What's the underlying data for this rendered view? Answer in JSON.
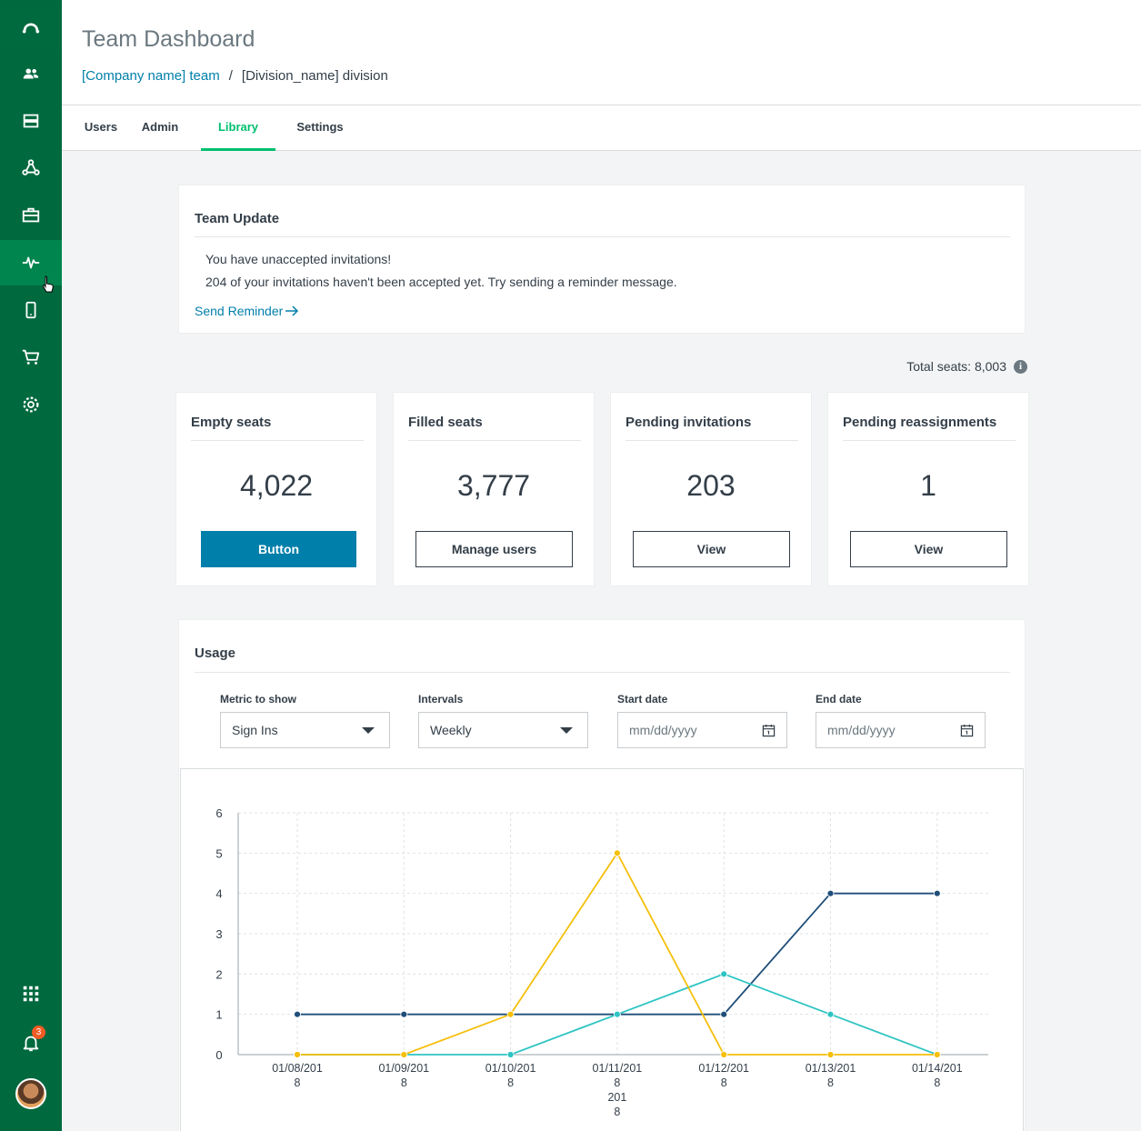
{
  "header": {
    "title": "Team Dashboard",
    "breadcrumb": {
      "link": "[Company name] team",
      "separator": "/",
      "current": "[Division_name] division"
    }
  },
  "tabs": [
    {
      "label": "Users",
      "active": false
    },
    {
      "label": "Admin",
      "active": false
    },
    {
      "label": "Library",
      "active": true
    },
    {
      "label": "Settings",
      "active": false
    }
  ],
  "sidebar": {
    "items": [
      {
        "icon": "logo-icon"
      },
      {
        "icon": "users-icon"
      },
      {
        "icon": "stack-icon"
      },
      {
        "icon": "network-icon"
      },
      {
        "icon": "briefcase-icon"
      },
      {
        "icon": "pulse-icon",
        "active": true
      },
      {
        "icon": "mobile-icon"
      },
      {
        "icon": "cart-icon"
      },
      {
        "icon": "gear-icon"
      },
      {
        "icon": "apps-grid-icon"
      },
      {
        "icon": "bell-icon",
        "badge": "3"
      },
      {
        "icon": "avatar"
      }
    ]
  },
  "team_update": {
    "title": "Team Update",
    "line1": "You have unaccepted invitations!",
    "line2": "204 of your invitations haven't been accepted yet. Try sending a reminder message.",
    "link": "Send Reminder"
  },
  "total_seats": "Total seats: 8,003",
  "stats": [
    {
      "title": "Empty seats",
      "value": "4,022",
      "button": "Button",
      "primary": true
    },
    {
      "title": "Filled seats",
      "value": "3,777",
      "button": "Manage users",
      "primary": false
    },
    {
      "title": "Pending invitations",
      "value": "203",
      "button": "View",
      "primary": false
    },
    {
      "title": "Pending reassignments",
      "value": "1",
      "button": "View",
      "primary": false
    }
  ],
  "usage": {
    "title": "Usage",
    "metric": {
      "label": "Metric to show",
      "value": "Sign Ins"
    },
    "intervals": {
      "label": "Intervals",
      "value": "Weekly"
    },
    "start_date": {
      "label": "Start date",
      "placeholder": "mm/dd/yyyy"
    },
    "end_date": {
      "label": "End date",
      "placeholder": "mm/dd/yyyy"
    }
  },
  "colors": {
    "sidebar": "#00693e",
    "accent": "#00bf6f",
    "link": "#007faa",
    "series_navy": "#1f4e79",
    "series_teal": "#2ec4c4",
    "series_yellow": "#f5bf0a"
  },
  "chart_data": {
    "type": "line",
    "x": [
      "01/08/2018",
      "01/09/2018",
      "01/10/2018",
      "01/11/2018",
      "01/12/2018",
      "01/13/2018",
      "01/14/2018"
    ],
    "x_tick_labels": [
      [
        "01/08/201",
        "8"
      ],
      [
        "01/09/201",
        "8"
      ],
      [
        "01/10/201",
        "8"
      ],
      [
        "01/11/201",
        "8",
        "201",
        "8"
      ],
      [
        "01/12/201",
        "8"
      ],
      [
        "01/13/201",
        "8"
      ],
      [
        "01/14/201",
        "8"
      ]
    ],
    "ylim": [
      0,
      6
    ],
    "yticks": [
      0,
      1,
      2,
      3,
      4,
      5,
      6
    ],
    "grid": true,
    "series": [
      {
        "color": "#1f4e79",
        "values": [
          1,
          1,
          1,
          1,
          1,
          4,
          4
        ]
      },
      {
        "color": "#2ec4c4",
        "values": [
          0,
          0,
          0,
          1,
          2,
          1,
          0
        ]
      },
      {
        "color": "#f5bf0a",
        "values": [
          0,
          0,
          1,
          5,
          0,
          0,
          0
        ]
      }
    ]
  }
}
